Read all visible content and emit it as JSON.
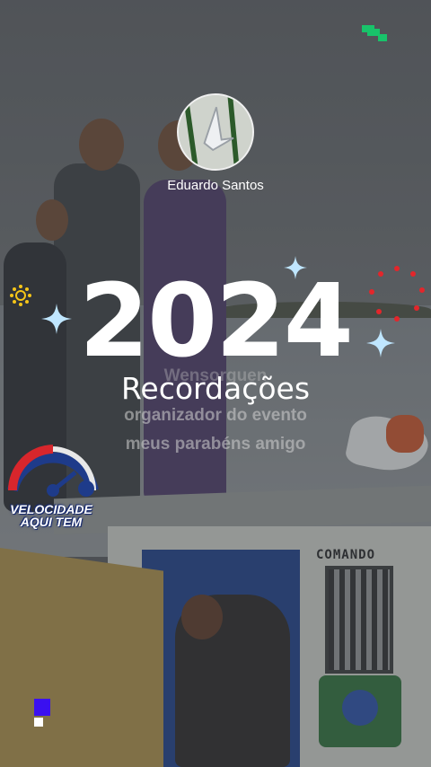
{
  "story": {
    "user": {
      "name": "Eduardo Santos",
      "avatar_icon": "avatar-image"
    },
    "year": "2024",
    "title": "Recordações",
    "caption_lines": [
      "Wensorguen",
      "organizador do evento",
      "meus parabéns amigo"
    ],
    "badge": {
      "lines": [
        "VELOCIDADE",
        "AQUI TEM"
      ]
    },
    "boat_sign": "COMANDO"
  },
  "colors": {
    "status_indicator": "#18c36a",
    "corner_mark": "#3a10f0",
    "dots": "#e3262b",
    "sparkle": "#bfe6ff",
    "sun": "#f5c518"
  }
}
